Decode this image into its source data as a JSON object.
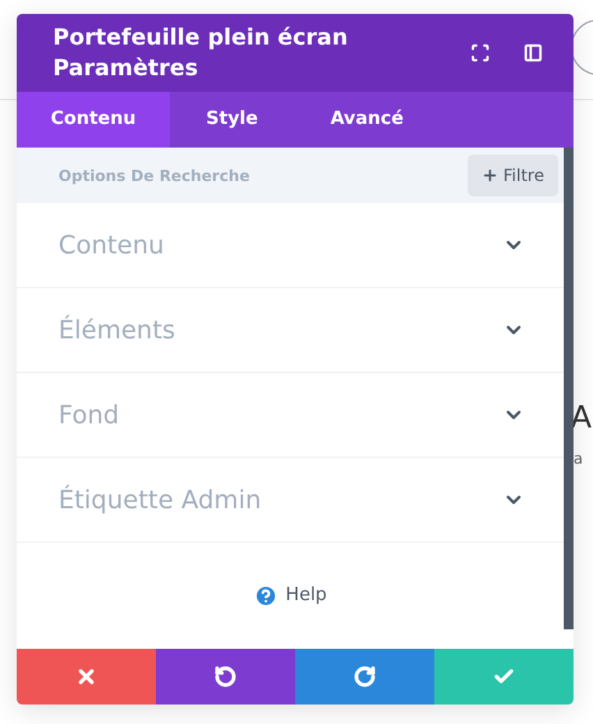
{
  "background": {
    "heading": "A",
    "text": "a"
  },
  "window": {
    "title_line_1": "Portefeuille plein écran",
    "title_line_2": "Paramètres"
  },
  "tabs": [
    {
      "label": "Contenu",
      "selected": true
    },
    {
      "label": "Style",
      "selected": false
    },
    {
      "label": "Avancé",
      "selected": false
    }
  ],
  "search": {
    "placeholder": "Options De Recherche",
    "filter_button": "Filtre"
  },
  "sections": [
    {
      "label": "Contenu",
      "expanded": false
    },
    {
      "label": "Éléments",
      "expanded": false
    },
    {
      "label": "Fond",
      "expanded": false
    },
    {
      "label": "Étiquette Admin",
      "expanded": false
    }
  ],
  "help": "Help",
  "footer_buttons": [
    {
      "kind": "cancel"
    },
    {
      "kind": "undo"
    },
    {
      "kind": "redo"
    },
    {
      "kind": "save"
    }
  ]
}
